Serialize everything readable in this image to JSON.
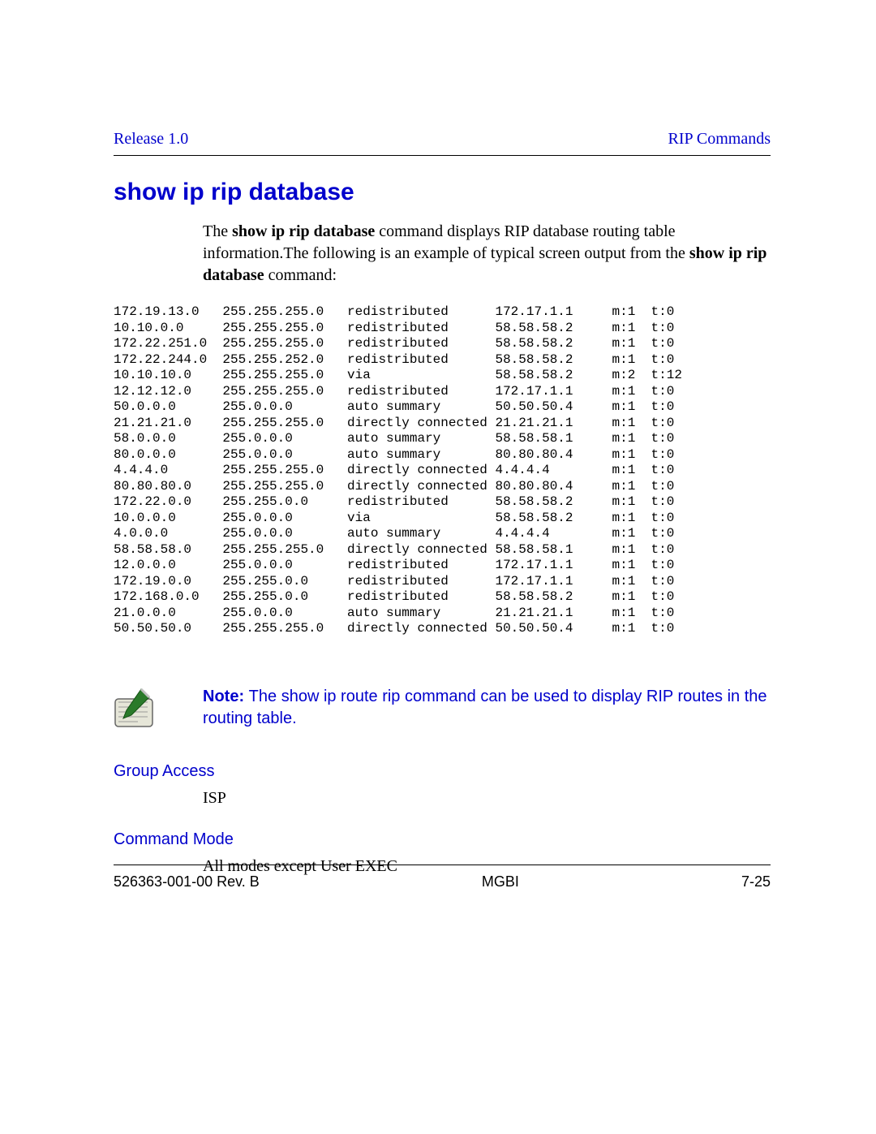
{
  "header": {
    "release": "Release 1.0",
    "section": "RIP Commands"
  },
  "title": "show ip rip database",
  "intro": {
    "prefix": "The ",
    "cmd1": "show ip rip database",
    "mid": " command displays RIP database routing table information.The following is an example of typical screen output from the ",
    "cmd2": "show ip rip database",
    "suffix": " command:"
  },
  "rows": [
    {
      "net": "172.19.13.0",
      "mask": "255.255.255.0",
      "type": "redistributed",
      "gw": "172.17.1.1",
      "m": "m:1",
      "t": "t:0"
    },
    {
      "net": "10.10.0.0",
      "mask": "255.255.255.0",
      "type": "redistributed",
      "gw": "58.58.58.2",
      "m": "m:1",
      "t": "t:0"
    },
    {
      "net": "172.22.251.0",
      "mask": "255.255.255.0",
      "type": "redistributed",
      "gw": "58.58.58.2",
      "m": "m:1",
      "t": "t:0"
    },
    {
      "net": "172.22.244.0",
      "mask": "255.255.252.0",
      "type": "redistributed",
      "gw": "58.58.58.2",
      "m": "m:1",
      "t": "t:0"
    },
    {
      "net": "10.10.10.0",
      "mask": "255.255.255.0",
      "type": "via",
      "gw": "58.58.58.2",
      "m": "m:2",
      "t": "t:12"
    },
    {
      "net": "12.12.12.0",
      "mask": "255.255.255.0",
      "type": "redistributed",
      "gw": "172.17.1.1",
      "m": "m:1",
      "t": "t:0"
    },
    {
      "net": "50.0.0.0",
      "mask": "255.0.0.0",
      "type": "auto summary",
      "gw": "50.50.50.4",
      "m": "m:1",
      "t": "t:0"
    },
    {
      "net": "21.21.21.0",
      "mask": "255.255.255.0",
      "type": "directly connected",
      "gw": "21.21.21.1",
      "m": "m:1",
      "t": "t:0"
    },
    {
      "net": "58.0.0.0",
      "mask": "255.0.0.0",
      "type": "auto summary",
      "gw": "58.58.58.1",
      "m": "m:1",
      "t": "t:0"
    },
    {
      "net": "80.0.0.0",
      "mask": "255.0.0.0",
      "type": "auto summary",
      "gw": "80.80.80.4",
      "m": "m:1",
      "t": "t:0"
    },
    {
      "net": "4.4.4.0",
      "mask": "255.255.255.0",
      "type": "directly connected",
      "gw": "4.4.4.4",
      "m": "m:1",
      "t": "t:0"
    },
    {
      "net": "80.80.80.0",
      "mask": "255.255.255.0",
      "type": "directly connected",
      "gw": "80.80.80.4",
      "m": "m:1",
      "t": "t:0"
    },
    {
      "net": "172.22.0.0",
      "mask": "255.255.0.0",
      "type": "redistributed",
      "gw": "58.58.58.2",
      "m": "m:1",
      "t": "t:0"
    },
    {
      "net": "10.0.0.0",
      "mask": "255.0.0.0",
      "type": "via",
      "gw": "58.58.58.2",
      "m": "m:1",
      "t": "t:0"
    },
    {
      "net": "4.0.0.0",
      "mask": "255.0.0.0",
      "type": "auto summary",
      "gw": "4.4.4.4",
      "m": "m:1",
      "t": "t:0"
    },
    {
      "net": "58.58.58.0",
      "mask": "255.255.255.0",
      "type": "directly connected",
      "gw": "58.58.58.1",
      "m": "m:1",
      "t": "t:0"
    },
    {
      "net": "12.0.0.0",
      "mask": "255.0.0.0",
      "type": "redistributed",
      "gw": "172.17.1.1",
      "m": "m:1",
      "t": "t:0"
    },
    {
      "net": "172.19.0.0",
      "mask": "255.255.0.0",
      "type": "redistributed",
      "gw": "172.17.1.1",
      "m": "m:1",
      "t": "t:0"
    },
    {
      "net": "172.168.0.0",
      "mask": "255.255.0.0",
      "type": "redistributed",
      "gw": "58.58.58.2",
      "m": "m:1",
      "t": "t:0"
    },
    {
      "net": "21.0.0.0",
      "mask": "255.0.0.0",
      "type": "auto summary",
      "gw": "21.21.21.1",
      "m": "m:1",
      "t": "t:0"
    },
    {
      "net": "50.50.50.0",
      "mask": "255.255.255.0",
      "type": "directly connected",
      "gw": "50.50.50.4",
      "m": "m:1",
      "t": "t:0"
    }
  ],
  "note": {
    "label": "Note: ",
    "text_a": "The show ip route rip command can be used to display RIP routes in the routing table."
  },
  "group_access": {
    "label": "Group Access",
    "value": "ISP"
  },
  "command_mode": {
    "label": "Command Mode",
    "value": "All modes except User EXEC"
  },
  "footer": {
    "left": "526363-001-00 Rev. B",
    "center": "MGBI",
    "right": "7-25"
  }
}
